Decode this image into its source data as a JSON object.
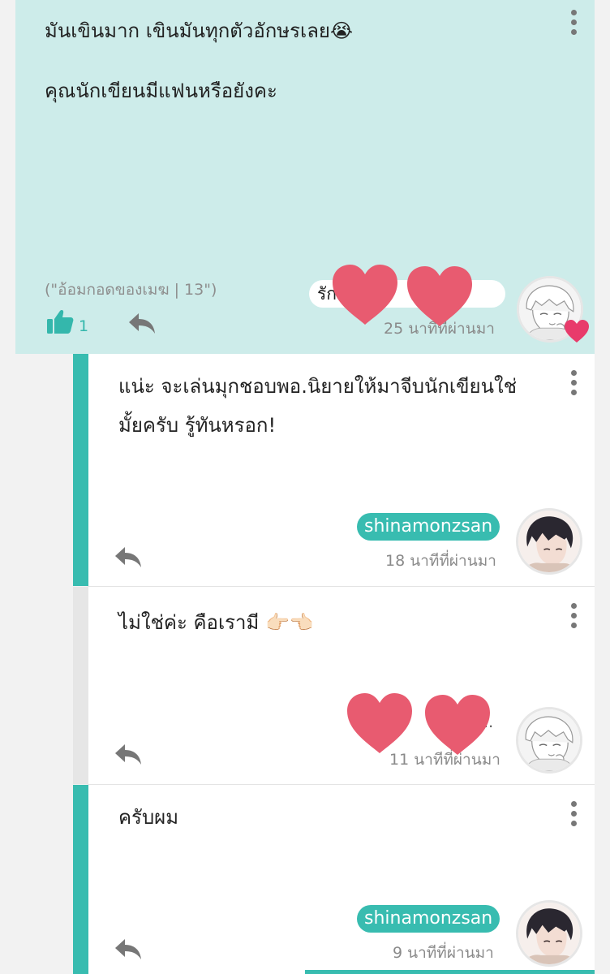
{
  "main_comment": {
    "line1": "มันเขินมาก เขินมันทุกตัวอักษรเลย😭",
    "line2": "คุณนักเขียนมีแฟนหรือยังคะ",
    "reference": "(\"อ้อมกอดของเมฆ | 13\")",
    "author_visible": "รัก                  เ              าย",
    "time": "25 นาทีที่ผ่านมา",
    "likes": "1",
    "colors": {
      "background": "#cdecea",
      "accent": "#34b7ac",
      "heart": "#e8566e"
    }
  },
  "replies": [
    {
      "lines": [
        "แน่ะ จะเล่นมุกชอบพอ.นิยายให้มาจีบนักเขียนใช่",
        "มั้ยครับ รู้ทันหรอก!"
      ],
      "author": "shinamonzsan",
      "time": "18 นาทีที่ผ่านมา",
      "bar_color": "#38bcb0"
    },
    {
      "lines": [
        "ไม่ใช่ค่ะ คือเรามี 👉🏻👈🏻"
      ],
      "author_visible": "...",
      "time": "11 นาทีที่ผ่านมา",
      "bar_color": "#e6e6e6"
    },
    {
      "lines": [
        "ครับผม"
      ],
      "author": "shinamonzsan",
      "time": "9 นาทีที่ผ่านมา",
      "bar_color": "#38bcb0"
    }
  ],
  "icons": {
    "more": "vertical-dots-icon",
    "like": "thumbs-up-icon",
    "reply": "reply-arrow-icon",
    "avatar_badge": "heart-icon",
    "sticker": "heart-sticker"
  }
}
